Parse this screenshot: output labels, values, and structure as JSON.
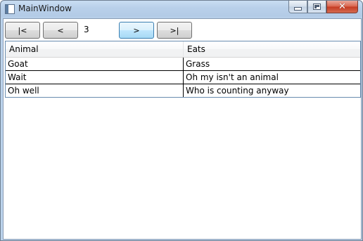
{
  "window": {
    "title": "MainWindow",
    "icon": "window-icon",
    "controls": {
      "minimize_icon": "minimize-icon",
      "maximize_icon": "maximize-icon",
      "close_icon": "close-icon",
      "close_glyph": "✕"
    }
  },
  "pager": {
    "first_label": "|<",
    "prev_label": "<",
    "current_page": "3",
    "next_label": ">",
    "last_label": ">|"
  },
  "grid": {
    "columns": [
      "Animal",
      "Eats"
    ],
    "rows": [
      {
        "animal": "Goat",
        "eats": "Grass"
      },
      {
        "animal": "Wait",
        "eats": "Oh my isn't an animal"
      },
      {
        "animal": "Oh well",
        "eats": "Who is counting anyway"
      }
    ]
  },
  "colors": {
    "focused_button_border": "#3c7fb1",
    "close_button": "#c43a22",
    "grid_border": "#688caf"
  }
}
